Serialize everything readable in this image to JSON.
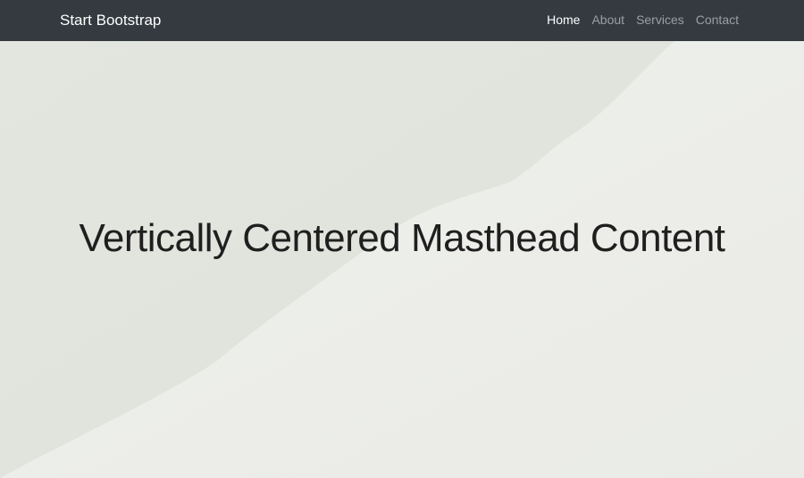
{
  "navbar": {
    "brand": "Start Bootstrap",
    "links": [
      {
        "label": "Home",
        "active": true
      },
      {
        "label": "About",
        "active": false
      },
      {
        "label": "Services",
        "active": false
      },
      {
        "label": "Contact",
        "active": false
      }
    ]
  },
  "masthead": {
    "headline": "Vertically Centered Masthead Content"
  },
  "colors": {
    "navbar_bg": "#343a40",
    "nav_link_active": "#ffffff",
    "nav_link_inactive": "#9a9da0",
    "background_light": "#eceeea",
    "background_shadow": "#e1e3dd",
    "headline_text": "#1f1f1f"
  }
}
